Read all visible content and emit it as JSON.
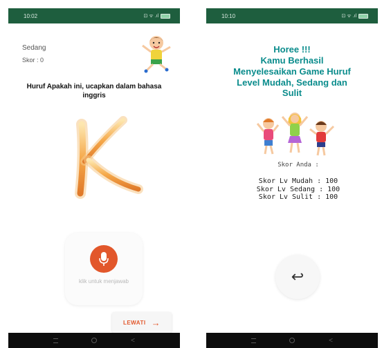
{
  "left_screen": {
    "status_bar": {
      "time": "10:02",
      "icons": "⊡ ᯤ .ıl"
    },
    "level": "Sedang",
    "score": "Skor : 0",
    "question": "Huruf Apakah ini, ucapkan dalam bahasa inggris",
    "letter": "K",
    "mic_caption": "klik untuk menjawab",
    "skip_label": "LEWATI",
    "skip_arrow": "→",
    "colors": {
      "accent": "#e2572b",
      "status_bar": "#1e5e3e"
    }
  },
  "right_screen": {
    "status_bar": {
      "time": "10:10",
      "icons": "⊡ ᯤ .ıl"
    },
    "congrats_lines": [
      "Horee !!!",
      "Kamu Berhasil",
      "Menyelesaikan Game Huruf",
      "Level Mudah, Sedang dan",
      "Sulit"
    ],
    "score_title": "Skor Anda :",
    "scores": [
      "Skor Lv Mudah : 100",
      "Skor Lv Sedang : 100",
      "Skor Lv Sulit : 100"
    ],
    "back_icon": "↩",
    "colors": {
      "heading": "#0a8c8c"
    }
  },
  "nav_bar": {
    "icons": [
      "recent-apps-icon",
      "home-icon",
      "back-icon"
    ],
    "back_glyph": "<"
  }
}
